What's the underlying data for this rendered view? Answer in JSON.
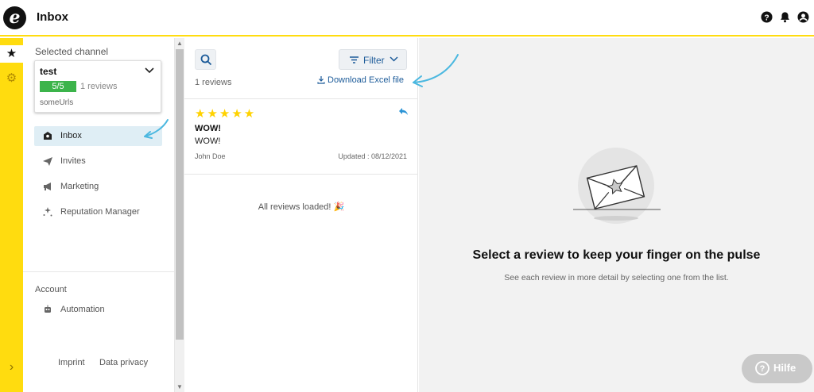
{
  "app": {
    "title": "Inbox",
    "logo_letter": "e"
  },
  "topbar_icons": [
    "help-icon",
    "bell-icon",
    "user-icon"
  ],
  "strip_icons": [
    "star-icon",
    "gear-icon",
    "chevron-right-icon"
  ],
  "sidebar": {
    "selected_channel_label": "Selected channel",
    "channel": {
      "name": "test",
      "score": "5/5",
      "reviews": "1 reviews",
      "url": "someUrls"
    },
    "nav": [
      {
        "label": "Inbox",
        "icon": "inbox-icon",
        "active": true
      },
      {
        "label": "Invites",
        "icon": "send-icon",
        "active": false
      },
      {
        "label": "Marketing",
        "icon": "megaphone-icon",
        "active": false
      },
      {
        "label": "Reputation Manager",
        "icon": "sparkle-icon",
        "active": false
      }
    ],
    "account_label": "Account",
    "account_items": [
      {
        "label": "Automation",
        "icon": "robot-icon"
      }
    ],
    "footer": {
      "imprint": "Imprint",
      "privacy": "Data privacy"
    }
  },
  "list": {
    "filter_label": "Filter",
    "count": "1 reviews",
    "download_label": "Download Excel file",
    "reviews": [
      {
        "stars": "★★★★★",
        "rating": 5,
        "title": "WOW!",
        "body": "WOW!",
        "author": "John Doe",
        "date": "Updated : 08/12/2021"
      }
    ],
    "loaded_text": "All reviews loaded! 🎉"
  },
  "detail": {
    "title": "Select a review to keep your finger on the pulse",
    "subtitle": "See each review in more detail by selecting one from the list."
  },
  "help": {
    "label": "Hilfe"
  },
  "colors": {
    "brand_yellow": "#ffdc0f",
    "link_blue": "#1c5b99",
    "score_green": "#3cb44b",
    "arrow_blue": "#4bb8e0"
  }
}
